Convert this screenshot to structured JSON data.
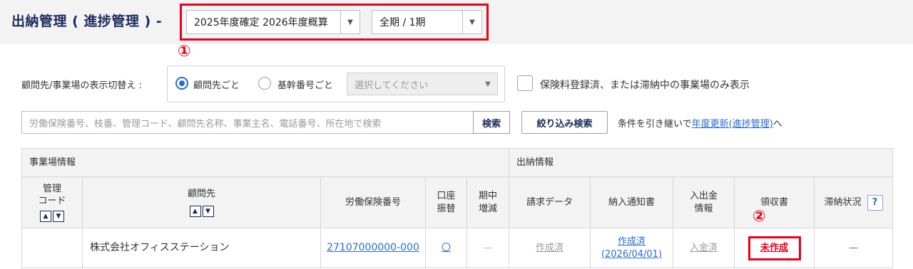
{
  "header": {
    "title": "出納管理 ( 進捗管理 ) -",
    "year_select": "2025年度確定 2026年度概算",
    "period_select": "全期 / 1期",
    "marker1": "①"
  },
  "filters": {
    "display_label": "顧問先/事業場の表示切替え :",
    "radio_client": "顧問先ごと",
    "radio_base": "基幹番号ごと",
    "base_select_placeholder": "選択してください",
    "checkbox_label": "保険料登録済、または滞納中の事業場のみ表示",
    "search_placeholder": "労働保険番号、枝番、管理コード、顧問先名称、事業主名、電話番号、所在地で検索",
    "search_button": "検索",
    "narrow_button": "絞り込み検索",
    "carry_text_prefix": "条件を引き継いで",
    "carry_link": "年度更新(進捗管理)",
    "carry_text_suffix": "へ"
  },
  "table": {
    "group_site": "事業場情報",
    "group_cash": "出納情報",
    "col_code_1": "管理",
    "col_code_2": "コード",
    "col_client": "顧問先",
    "col_number": "労働保険番号",
    "col_account_1": "口座",
    "col_account_2": "振替",
    "col_mid_1": "期中",
    "col_mid_2": "増減",
    "col_invoice": "請求データ",
    "col_notice": "納入通知書",
    "col_inout_1": "入出金",
    "col_inout_2": "情報",
    "col_receipt": "領収書",
    "col_arrears": "滞納状況",
    "help_label": "?",
    "marker2": "②",
    "rows": [
      {
        "code": "",
        "client": "株式会社オフィスステーション",
        "number": "27107000000-000",
        "account": "〇",
        "mid": "—",
        "invoice": "作成済",
        "notice_1": "作成済",
        "notice_2": "(2026/04/01)",
        "inout": "入金済",
        "receipt": "未作成",
        "arrears": "—"
      }
    ]
  }
}
